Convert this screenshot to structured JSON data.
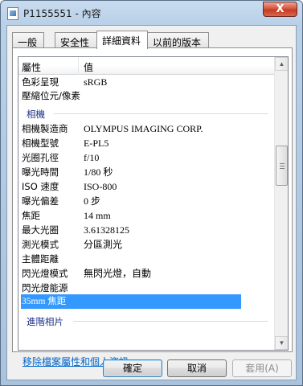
{
  "window": {
    "title": "P1155551 - 內容",
    "close_glyph": "X"
  },
  "tabs": [
    {
      "label": "一般"
    },
    {
      "label": "安全性"
    },
    {
      "label": "詳細資料",
      "active": true
    },
    {
      "label": "以前的版本"
    }
  ],
  "list": {
    "header": {
      "property": "屬性",
      "value": "值"
    },
    "rows_top": [
      {
        "key": "色彩呈現",
        "value": "sRGB"
      },
      {
        "key": "壓縮位元/像素",
        "value": ""
      }
    ],
    "group_camera": "相機",
    "rows_camera": [
      {
        "key": "相機製造商",
        "value": "OLYMPUS IMAGING CORP."
      },
      {
        "key": "相機型號",
        "value": "E-PL5"
      },
      {
        "key": "光圈孔徑",
        "value": "f/10"
      },
      {
        "key": "曝光時間",
        "value": "1/80 秒"
      },
      {
        "key": "ISO 速度",
        "value": "ISO-800"
      },
      {
        "key": "曝光偏差",
        "value": "0 步"
      },
      {
        "key": "焦距",
        "value": "14 mm"
      },
      {
        "key": "最大光圈",
        "value": "3.61328125"
      },
      {
        "key": "測光模式",
        "value": "分區測光"
      },
      {
        "key": "主體距離",
        "value": ""
      },
      {
        "key": "閃光燈模式",
        "value": "無閃光燈，自動"
      },
      {
        "key": "閃光燈能源",
        "value": ""
      }
    ],
    "selected_row": {
      "key": "35mm 焦距",
      "value": ""
    },
    "group_advanced": "進階相片"
  },
  "remove_link": "移除檔案屬性和個人資訊",
  "buttons": {
    "ok": "確定",
    "cancel": "取消",
    "apply": "套用(A)"
  }
}
